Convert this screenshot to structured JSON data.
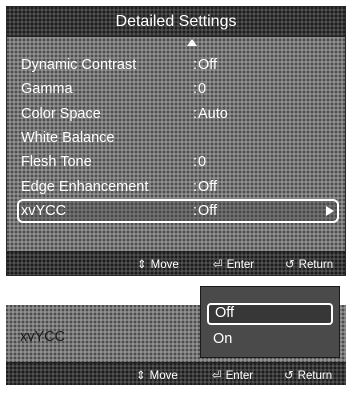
{
  "screen1": {
    "title": "Detailed Settings",
    "rows": [
      {
        "label": "Dynamic Contrast",
        "sep": ":",
        "value": "Off"
      },
      {
        "label": "Gamma",
        "sep": ":",
        "value": "0"
      },
      {
        "label": "Color Space",
        "sep": ":",
        "value": "Auto"
      },
      {
        "label": "White Balance",
        "sep": "",
        "value": ""
      },
      {
        "label": "Flesh Tone",
        "sep": ":",
        "value": "0"
      },
      {
        "label": "Edge Enhancement",
        "sep": ":",
        "value": "Off"
      },
      {
        "label": "xvYCC",
        "sep": ":",
        "value": "Off"
      }
    ],
    "help": {
      "move": "Move",
      "enter": "Enter",
      "return": "Return"
    }
  },
  "screen2": {
    "label": "xvYCC",
    "options": [
      "Off",
      "On"
    ],
    "selected_option": "Off",
    "help": {
      "move": "Move",
      "enter": "Enter",
      "return": "Return"
    }
  },
  "icons": {
    "up": "up-arrow-icon",
    "right": "right-arrow-icon",
    "move": "move-icon",
    "enter": "enter-icon",
    "return": "return-icon"
  },
  "colors": {
    "panel_bg": "#7a7a7a",
    "dark_bar": "#3a3a3a",
    "text": "#ffffff"
  }
}
